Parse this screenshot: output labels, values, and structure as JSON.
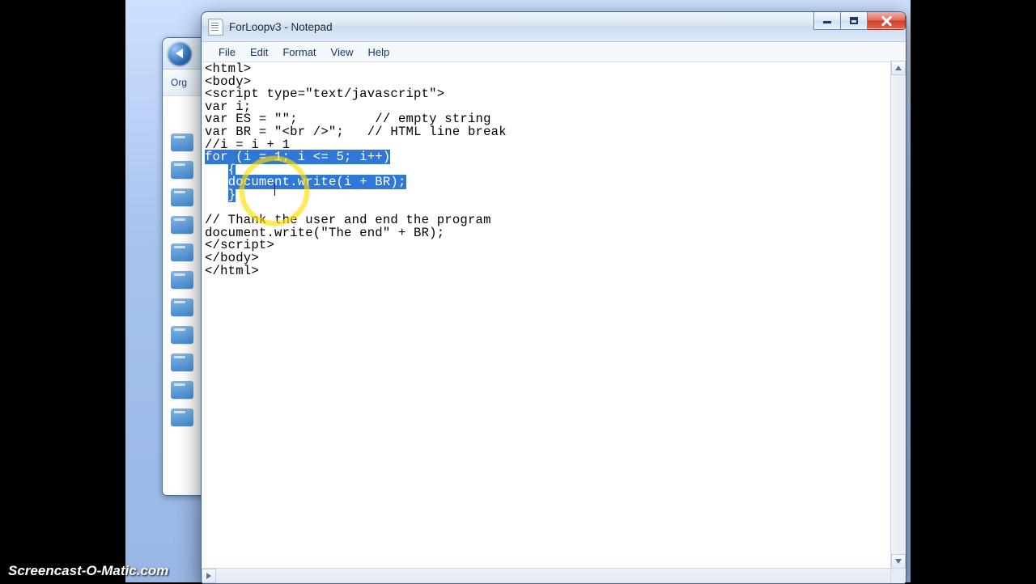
{
  "window": {
    "title": "ForLoopv3 - Notepad"
  },
  "menu": {
    "file": "File",
    "edit": "Edit",
    "format": "Format",
    "view": "View",
    "help": "Help"
  },
  "explorer": {
    "toolbar_label": "Org"
  },
  "code": {
    "l1": "<html>",
    "l2": "<body>",
    "l3": "<script type=\"text/javascript\">",
    "l4": "var i;",
    "l5a": "var ES = \"\";",
    "l5b": "          // empty string",
    "l6a": "var BR = \"<br />\";",
    "l6b": "   // HTML line break",
    "l7": "//i = i + 1",
    "l8": "for (i = 1; i <= 5; i++)",
    "l9a": "   ",
    "l9b": "{",
    "l10a": "   ",
    "l10b": "document.write(i + BR);",
    "l11a": "   ",
    "l11b": "}",
    "l12": "",
    "l13": "// Thank the user and end the program",
    "l14": "document.write(\"The end\" + BR);",
    "l15": "</script>",
    "l16": "</body>",
    "l17": "</html>"
  },
  "watermark": "Screencast-O-Matic.com"
}
